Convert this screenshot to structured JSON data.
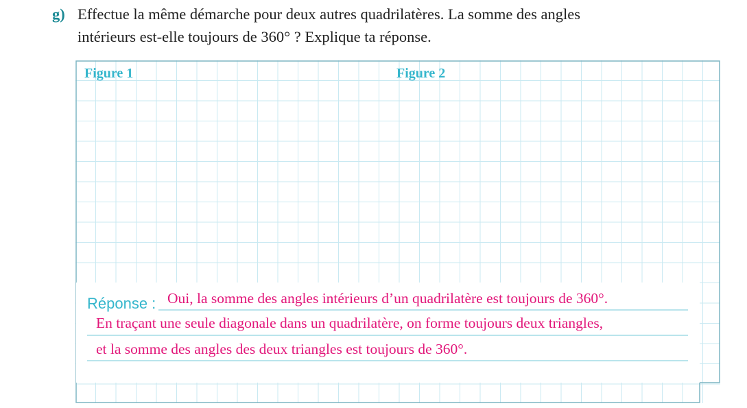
{
  "question": {
    "letter": "g)",
    "line1": "Effectue la même démarche pour deux autres quadrilatères. La somme des angles",
    "line2": "intérieurs est-elle toujours de 360° ? Explique ta réponse."
  },
  "grid": {
    "figure1_label": "Figure 1",
    "figure2_label": "Figure 2"
  },
  "answer": {
    "label": "Réponse :",
    "line1": "Oui, la somme des angles intérieurs d’un quadrilatère est toujours de 360°.",
    "line2": "En traçant une seule diagonale dans un quadrilatère, on forme toujours deux triangles,",
    "line3": "et la somme des angles des deux triangles est toujours de 360°."
  },
  "colors": {
    "accent_teal": "#1c8a95",
    "label_cyan": "#35b6cc",
    "grid_line": "#c9e9f2",
    "answer_pink": "#e2177a"
  }
}
